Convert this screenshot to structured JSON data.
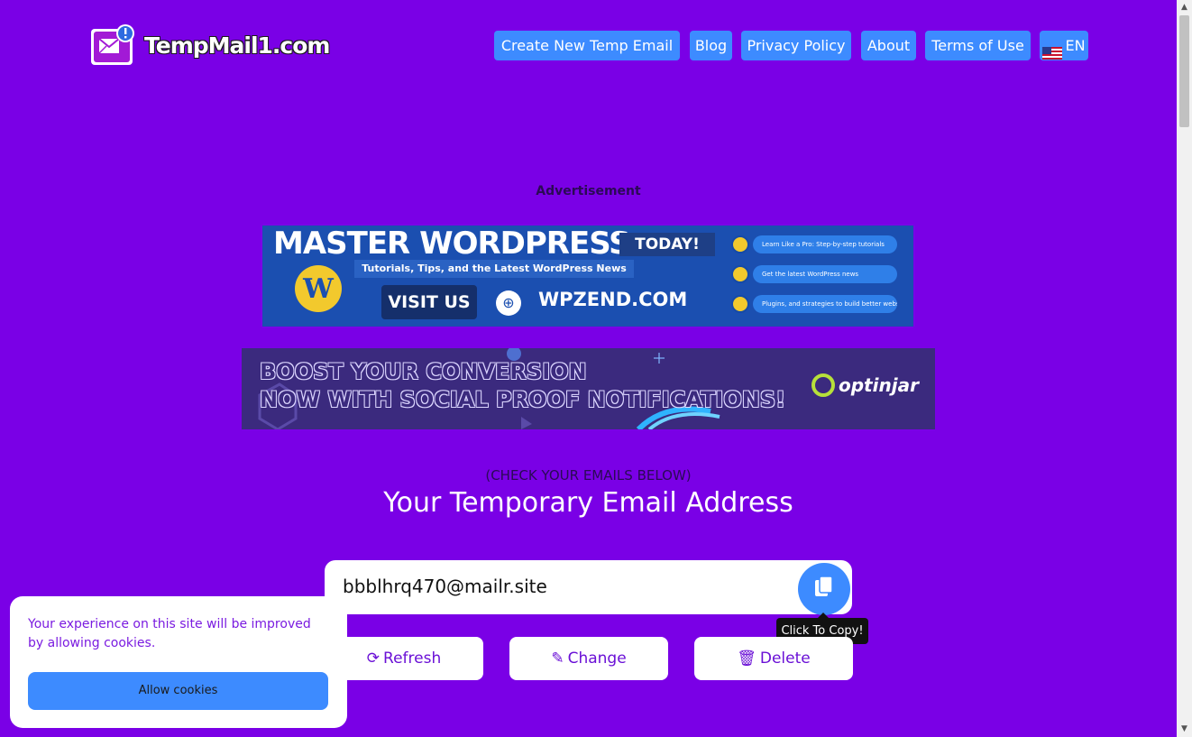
{
  "header": {
    "logo_text": "TempMail1.com",
    "nav": [
      {
        "label": "Create New Temp Email"
      },
      {
        "label": "Blog"
      },
      {
        "label": "Privacy Policy"
      },
      {
        "label": "About"
      },
      {
        "label": "Terms of Use"
      },
      {
        "label": "EN"
      }
    ]
  },
  "ads": {
    "label": "Advertisement",
    "banner1": {
      "title": "MASTER WORDPRESS",
      "today": "TODAY!",
      "subtitle": "Tutorials, Tips, and the Latest WordPress News",
      "visit": "VISIT US",
      "domain": "WPZEND.COM",
      "items": [
        "Learn Like a Pro: Step-by-step tutorials",
        "Get the latest WordPress news",
        "Plugins, and strategies to build better websites."
      ]
    },
    "banner2": {
      "line1": "BOOST YOUR CONVERSION",
      "line2": "NOW WITH SOCIAL PROOF NOTIFICATIONS!",
      "brand": "optinjar"
    }
  },
  "main": {
    "check_label": "(CHECK YOUR EMAILS BELOW)",
    "heading": "Your Temporary Email Address",
    "email_value": "bbblhrq470@mailr.site",
    "tooltip": "Click To Copy!",
    "actions": [
      {
        "label": "Refresh",
        "icon": "refresh-icon"
      },
      {
        "label": "Change",
        "icon": "pencil-icon"
      },
      {
        "label": "Delete",
        "icon": "trash-icon"
      }
    ]
  },
  "cookie": {
    "text": "Your experience on this site will be improved by allowing cookies.",
    "button": "Allow cookies"
  },
  "colors": {
    "background": "#7a00e6",
    "accent": "#3d8bff",
    "button_text": "#6a10d6"
  }
}
